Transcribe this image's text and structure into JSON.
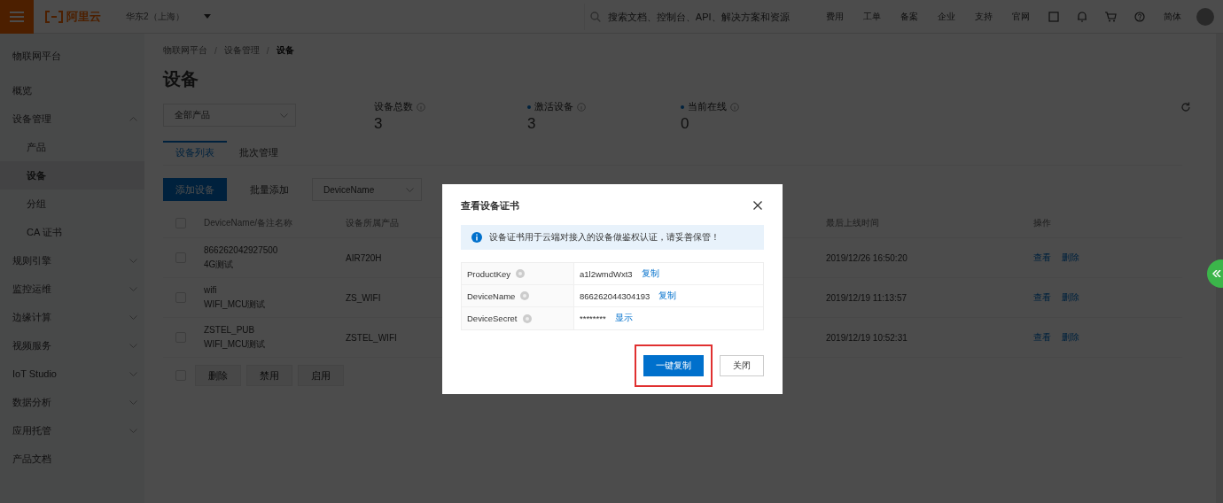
{
  "topbar": {
    "logo": "阿里云",
    "region": "华东2（上海）",
    "search": {
      "placeholder": "搜索文档、控制台、API、解决方案和资源"
    },
    "links": [
      "费用",
      "工单",
      "备案",
      "企业",
      "支持",
      "官网"
    ],
    "language": "简体"
  },
  "sidebar": {
    "title": "物联网平台",
    "items": [
      {
        "label": "概览",
        "expandable": false,
        "selected": false
      },
      {
        "label": "设备管理",
        "expandable": true,
        "expanded": true,
        "selected": false,
        "children": [
          {
            "label": "产品",
            "selected": false
          },
          {
            "label": "设备",
            "selected": true
          },
          {
            "label": "分组",
            "selected": false
          },
          {
            "label": "CA 证书",
            "selected": false
          }
        ]
      },
      {
        "label": "规则引擎",
        "expandable": true,
        "expanded": false,
        "selected": false
      },
      {
        "label": "监控运维",
        "expandable": true,
        "expanded": false,
        "selected": false
      },
      {
        "label": "边缘计算",
        "expandable": true,
        "expanded": false,
        "selected": false
      },
      {
        "label": "视频服务",
        "expandable": true,
        "expanded": false,
        "selected": false
      },
      {
        "label": "IoT Studio",
        "expandable": true,
        "expanded": false,
        "selected": false
      },
      {
        "label": "数据分析",
        "expandable": true,
        "expanded": false,
        "selected": false
      },
      {
        "label": "应用托管",
        "expandable": true,
        "expanded": false,
        "selected": false
      },
      {
        "label": "产品文档",
        "expandable": false,
        "selected": false
      }
    ]
  },
  "breadcrumb": [
    {
      "kind": "link",
      "text": "物联网平台"
    },
    {
      "kind": "separator",
      "text": "/"
    },
    {
      "kind": "link",
      "text": "设备管理"
    },
    {
      "kind": "separator",
      "text": "/"
    },
    {
      "kind": "current",
      "text": "设备"
    }
  ],
  "page_title": "设备",
  "product_select": "全部产品",
  "stats": [
    {
      "label": "设备总数",
      "value": "3",
      "dot": false,
      "info": true
    },
    {
      "label": "激活设备",
      "value": "3",
      "dot": true,
      "info": true
    },
    {
      "label": "当前在线",
      "value": "0",
      "dot": true,
      "info": true
    }
  ],
  "tabs": [
    {
      "label": "设备列表",
      "selected": true
    },
    {
      "label": "批次管理",
      "selected": false
    }
  ],
  "toolbar": {
    "add_button": "添加设备",
    "batch_button": "批量添加",
    "filter_select": "DeviceName"
  },
  "table": {
    "all_checked": false,
    "columns": [
      "DeviceName/备注名称",
      "设备所属产品",
      "最后上线时间",
      "操作"
    ],
    "rows": [
      {
        "checked": false,
        "name": "866262042927500",
        "note": "4G测试",
        "product": "AIR720H",
        "last_online": "2019/12/26 16:50:20",
        "actions": [
          "查看",
          "删除"
        ]
      },
      {
        "checked": false,
        "name": "wifi",
        "note": "WIFI_MCU测试",
        "product": "ZS_WIFI",
        "last_online": "2019/12/19 11:13:57",
        "actions": [
          "查看",
          "删除"
        ]
      },
      {
        "checked": false,
        "name": "ZSTEL_PUB",
        "note": "WIFI_MCU测试",
        "product": "ZSTEL_WIFI",
        "last_online": "2019/12/19 10:52:31",
        "actions": [
          "查看",
          "删除"
        ]
      }
    ]
  },
  "batch": {
    "checked": false,
    "actions": [
      "删除",
      "禁用",
      "启用"
    ]
  },
  "dialog": {
    "title": "查看设备证书",
    "notice": "设备证书用于云端对接入的设备做鉴权认证，请妥善保管！",
    "fields": [
      {
        "label": "ProductKey",
        "value": "a1l2wmdWxt3",
        "action": "复制"
      },
      {
        "label": "DeviceName",
        "value": "866262044304193",
        "action": "复制"
      },
      {
        "label": "DeviceSecret",
        "value": "********",
        "action": "显示"
      }
    ],
    "buttons": [
      {
        "label": "一键复制",
        "kind": "primary",
        "highlighted": true
      },
      {
        "label": "关闭",
        "kind": "secondary",
        "highlighted": false
      }
    ]
  }
}
